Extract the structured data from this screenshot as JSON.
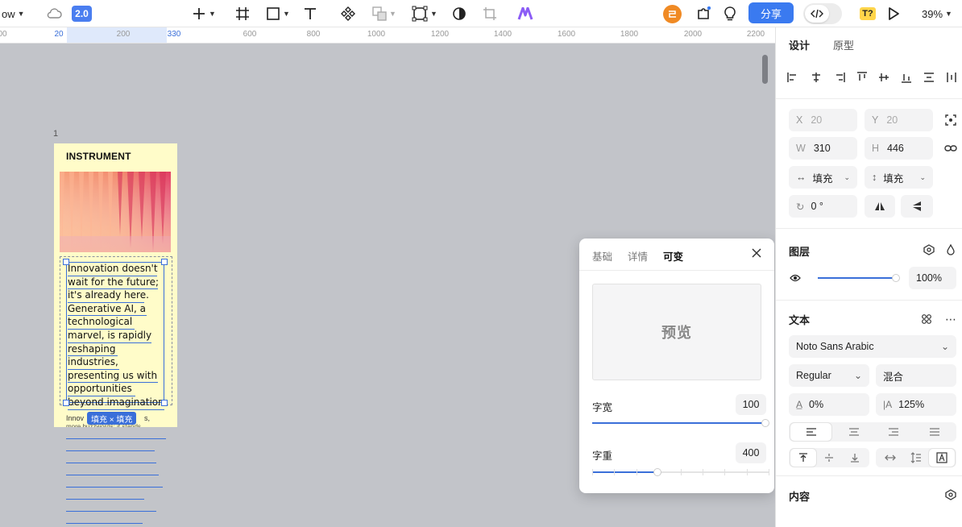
{
  "toolbar": {
    "file_name_fragment": "ow",
    "version_badge": "2.0",
    "share_label": "分享",
    "zoom_label": "39%",
    "plugin_badge": "T?"
  },
  "ruler": {
    "ticks": [
      "00",
      "20",
      "200",
      "330",
      "600",
      "800",
      "1000",
      "1200",
      "1400",
      "1600",
      "1800",
      "2000",
      "2200"
    ]
  },
  "canvas": {
    "frame_number": "1",
    "frame_heading": "INSTRUMENT",
    "selected_text": [
      "Innovation doesn't",
      "wait for the future;",
      "it's already here.",
      "Generative AI, a",
      "technological",
      "marvel, is rapidly",
      "reshaping",
      "industries,",
      "presenting us with",
      "opportunities",
      "beyond imagination."
    ],
    "secondary_text_fragment_1": "Innov",
    "secondary_text_fragment_2": "s,",
    "secondary_text_fragment_3": "more buzzwords; it stands",
    "size_badge": "填充 × 填充"
  },
  "popover": {
    "tabs": [
      "基础",
      "详情",
      "可变"
    ],
    "active_tab": "可变",
    "preview_label": "预览",
    "width_label": "字宽",
    "width_value": "100",
    "width_level": 1.0,
    "weight_label": "字重",
    "weight_value": "400",
    "weight_level": 0.37
  },
  "panel": {
    "tabs": [
      "设计",
      "原型"
    ],
    "x_label": "X",
    "x_value": "20",
    "y_label": "Y",
    "y_value": "20",
    "w_label": "W",
    "w_value": "310",
    "h_label": "H",
    "h_value": "446",
    "h_fill": "填充",
    "v_fill": "填充",
    "rotation": "0 °",
    "layer_title": "图层",
    "opacity": "100%",
    "opacity_level": 1.0,
    "text_title": "文本",
    "font_family": "Noto Sans Arabic",
    "font_style": "Regular",
    "blend": "混合",
    "letter_spacing": "0%",
    "line_height": "125%",
    "content_title": "内容"
  },
  "colors": {
    "accent": "#3a6fd9",
    "share_button": "#3a7af0",
    "frame_bg": "#fffcc9",
    "avatar": "#f08a24",
    "plugin_badge_bg": "#ffd54a"
  }
}
